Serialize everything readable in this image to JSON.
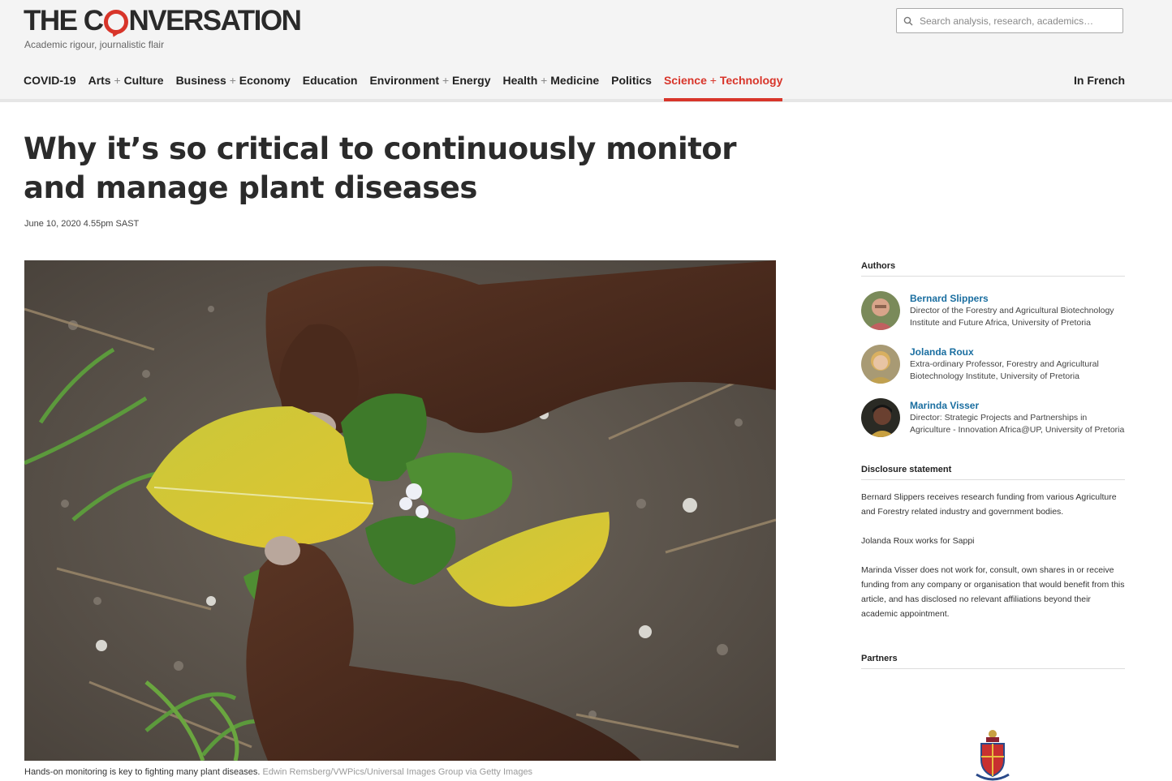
{
  "site": {
    "logo_left": "THE C",
    "logo_right": "NVERSATION",
    "tagline": "Academic rigour, journalistic flair"
  },
  "search": {
    "placeholder": "Search analysis, research, academics…"
  },
  "nav": {
    "items": [
      {
        "label": "COVID-19"
      },
      {
        "part1": "Arts",
        "part2": "Culture"
      },
      {
        "part1": "Business",
        "part2": "Economy"
      },
      {
        "label": "Education"
      },
      {
        "part1": "Environment",
        "part2": "Energy"
      },
      {
        "part1": "Health",
        "part2": "Medicine"
      },
      {
        "label": "Politics"
      },
      {
        "part1": "Science",
        "part2": "Technology",
        "active": true
      }
    ],
    "plus": "+",
    "in_french": "In French"
  },
  "article": {
    "headline": "Why it’s so critical to continuously monitor and manage plant diseases",
    "date": "June 10, 2020 4.55pm SAST",
    "caption": "Hands-on monitoring is key to fighting many plant diseases.",
    "credit": "Edwin Remsberg/VWPics/Universal Images Group via Getty Images"
  },
  "sidebar": {
    "authors_heading": "Authors",
    "authors": [
      {
        "name": "Bernard Slippers",
        "role": "Director of the Forestry and Agricultural Biotechnology Institute and Future Africa, University of Pretoria"
      },
      {
        "name": "Jolanda Roux",
        "role": "Extra-ordinary Professor, Forestry and Agricultural Biotechnology Institute, University of Pretoria"
      },
      {
        "name": "Marinda Visser",
        "role": "Director: Strategic Projects and Partnerships in Agriculture - Innovation Africa@UP, University of Pretoria"
      }
    ],
    "disclosure_heading": "Disclosure statement",
    "disclosure": [
      "Bernard Slippers receives research funding from various Agriculture and Forestry related industry and government bodies.",
      "Jolanda Roux works for Sappi",
      "Marinda Visser does not work for, consult, own shares in or receive funding from any company or organisation that would benefit from this article, and has disclosed no relevant affiliations beyond their academic appointment."
    ],
    "partners_heading": "Partners"
  },
  "colors": {
    "brand_red": "#d8352a",
    "link_blue": "#1a6ea0"
  }
}
